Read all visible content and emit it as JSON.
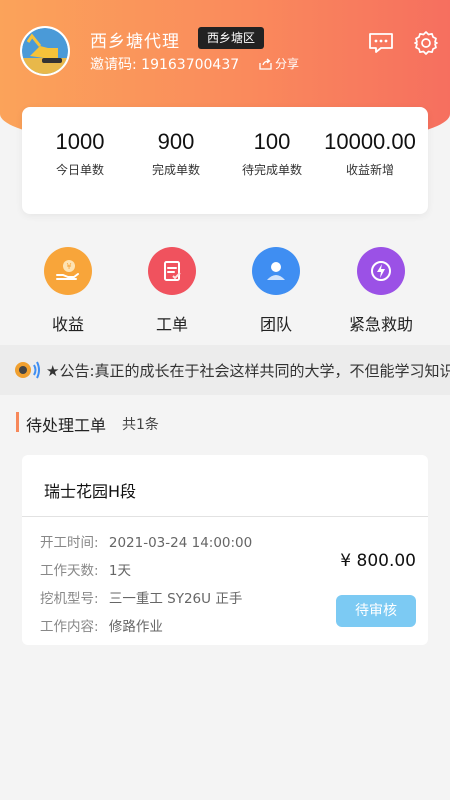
{
  "header": {
    "username": "西乡塘代理",
    "area_badge": "西乡塘区",
    "invite_label": "邀请码:",
    "invite_code": "19163700437",
    "share_label": "分享",
    "icons": [
      "message-icon",
      "gear-icon"
    ],
    "gradient_colors": [
      "#fba35a",
      "#f66f5f"
    ]
  },
  "stats": [
    {
      "value": "1000",
      "label": "今日单数"
    },
    {
      "value": "900",
      "label": "完成单数"
    },
    {
      "value": "100",
      "label": "待完成单数"
    },
    {
      "value": "10000.00",
      "label": "收益新增"
    }
  ],
  "menu": [
    {
      "label": "收益",
      "icon": "income-icon",
      "color": "#f8a53a"
    },
    {
      "label": "工单",
      "icon": "work-order-icon",
      "color": "#f0525e"
    },
    {
      "label": "团队",
      "icon": "team-icon",
      "color": "#3f8ef2"
    },
    {
      "label": "紧急救助",
      "icon": "emergency-icon",
      "color": "#9b51e6"
    }
  ],
  "notice": {
    "text": "★公告:真正的成长在于社会这样共同的大学，不但能学习知识"
  },
  "section": {
    "title": "待处理工单",
    "count": "共1条",
    "accent": "#f7885a"
  },
  "order": {
    "title": "瑞士花园H段",
    "rows": [
      {
        "key": "开工时间:",
        "value": "2021-03-24 14:00:00"
      },
      {
        "key": "工作天数:",
        "value": "1天"
      },
      {
        "key": "挖机型号:",
        "value": "三一重工 SY26U 正手"
      },
      {
        "key": "工作内容:",
        "value": "修路作业"
      }
    ],
    "price": "¥ 800.00",
    "status": "待审核",
    "status_color": "#7ccaf3"
  }
}
